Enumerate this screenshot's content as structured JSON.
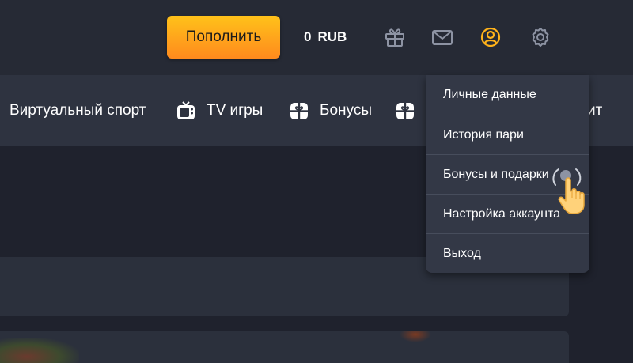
{
  "header": {
    "deposit_label": "Пополнить",
    "balance_amount": "0",
    "balance_currency": "RUB",
    "icons": [
      "gift-icon",
      "mail-icon",
      "user-icon",
      "gear-icon"
    ],
    "accent_color": "#ffb21a"
  },
  "nav": {
    "items": [
      {
        "label": "Виртуальный спорт",
        "icon": ""
      },
      {
        "label": "TV игры",
        "icon": "tv-icon"
      },
      {
        "label": "Бонусы",
        "icon": "gift-box-icon"
      },
      {
        "label": "ит",
        "icon": "gift-box-icon"
      }
    ]
  },
  "account_menu": {
    "items": [
      {
        "label": "Личные данные"
      },
      {
        "label": "История пари"
      },
      {
        "label": "Бонусы и подарки"
      },
      {
        "label": "Настройка аккаунта"
      },
      {
        "label": "Выход"
      }
    ]
  }
}
